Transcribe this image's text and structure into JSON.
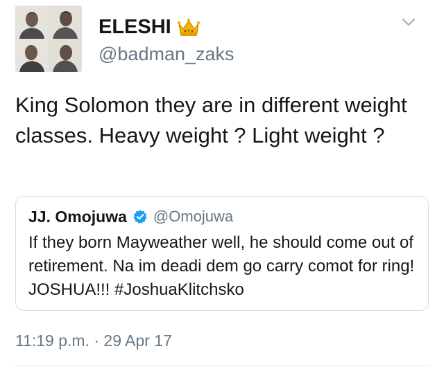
{
  "author": {
    "display_name": "ELESHI",
    "handle": "@badman_zaks",
    "badge_icon": "crown-icon",
    "avatar_icon": "profile-photo-grid"
  },
  "tweet": {
    "text": "King Solomon they are in different weight classes. Heavy weight ? Light weight ?",
    "timestamp": "11:19 p.m. · 29 Apr 17",
    "menu_icon": "chevron-down-icon"
  },
  "quoted_tweet": {
    "display_name": "JJ. Omojuwa",
    "verified_icon": "verified-badge-icon",
    "handle": "@Omojuwa",
    "text": "If they born Mayweather well, he should come out of retirement. Na im deadi dem go carry comot for ring! JOSHUA!!! #JoshuaKlitchsko"
  },
  "colors": {
    "text_primary": "#14171a",
    "text_secondary": "#657786",
    "border": "#d7dde2",
    "verified_blue": "#1da1f2",
    "crown_gold": "#f5b400"
  }
}
